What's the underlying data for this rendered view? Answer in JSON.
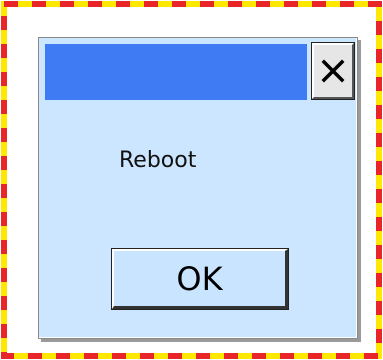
{
  "window": {
    "title": "",
    "close_icon": "close-icon",
    "message": "Reboot",
    "ok_label": "OK"
  },
  "colors": {
    "border_red": "#e8262a",
    "border_yellow": "#ffe800",
    "dialog_bg": "#cce6ff",
    "titlebar": "#3f7cf4"
  }
}
